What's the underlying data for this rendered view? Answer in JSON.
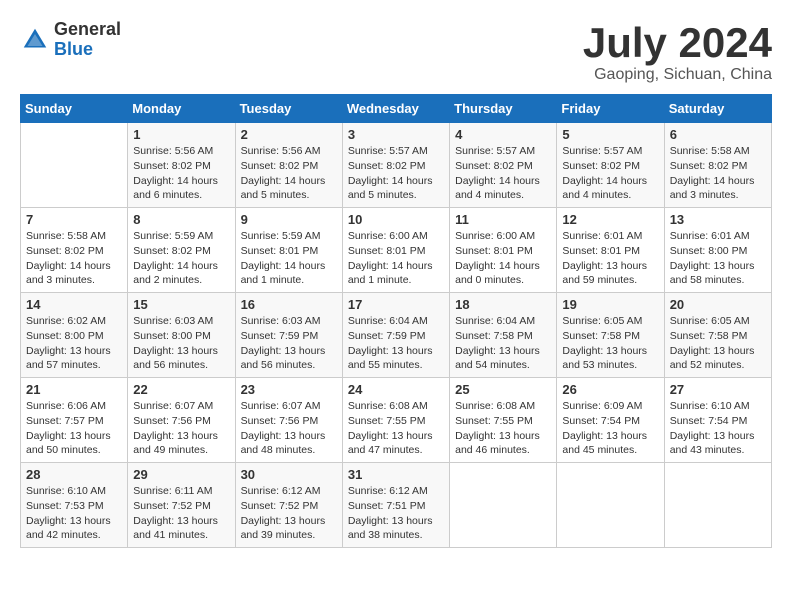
{
  "logo": {
    "general": "General",
    "blue": "Blue"
  },
  "title": {
    "month_year": "July 2024",
    "location": "Gaoping, Sichuan, China"
  },
  "calendar": {
    "headers": [
      "Sunday",
      "Monday",
      "Tuesday",
      "Wednesday",
      "Thursday",
      "Friday",
      "Saturday"
    ],
    "weeks": [
      [
        {
          "day": "",
          "sunrise": "",
          "sunset": "",
          "daylight": ""
        },
        {
          "day": "1",
          "sunrise": "Sunrise: 5:56 AM",
          "sunset": "Sunset: 8:02 PM",
          "daylight": "Daylight: 14 hours and 6 minutes."
        },
        {
          "day": "2",
          "sunrise": "Sunrise: 5:56 AM",
          "sunset": "Sunset: 8:02 PM",
          "daylight": "Daylight: 14 hours and 5 minutes."
        },
        {
          "day": "3",
          "sunrise": "Sunrise: 5:57 AM",
          "sunset": "Sunset: 8:02 PM",
          "daylight": "Daylight: 14 hours and 5 minutes."
        },
        {
          "day": "4",
          "sunrise": "Sunrise: 5:57 AM",
          "sunset": "Sunset: 8:02 PM",
          "daylight": "Daylight: 14 hours and 4 minutes."
        },
        {
          "day": "5",
          "sunrise": "Sunrise: 5:57 AM",
          "sunset": "Sunset: 8:02 PM",
          "daylight": "Daylight: 14 hours and 4 minutes."
        },
        {
          "day": "6",
          "sunrise": "Sunrise: 5:58 AM",
          "sunset": "Sunset: 8:02 PM",
          "daylight": "Daylight: 14 hours and 3 minutes."
        }
      ],
      [
        {
          "day": "7",
          "sunrise": "Sunrise: 5:58 AM",
          "sunset": "Sunset: 8:02 PM",
          "daylight": "Daylight: 14 hours and 3 minutes."
        },
        {
          "day": "8",
          "sunrise": "Sunrise: 5:59 AM",
          "sunset": "Sunset: 8:02 PM",
          "daylight": "Daylight: 14 hours and 2 minutes."
        },
        {
          "day": "9",
          "sunrise": "Sunrise: 5:59 AM",
          "sunset": "Sunset: 8:01 PM",
          "daylight": "Daylight: 14 hours and 1 minute."
        },
        {
          "day": "10",
          "sunrise": "Sunrise: 6:00 AM",
          "sunset": "Sunset: 8:01 PM",
          "daylight": "Daylight: 14 hours and 1 minute."
        },
        {
          "day": "11",
          "sunrise": "Sunrise: 6:00 AM",
          "sunset": "Sunset: 8:01 PM",
          "daylight": "Daylight: 14 hours and 0 minutes."
        },
        {
          "day": "12",
          "sunrise": "Sunrise: 6:01 AM",
          "sunset": "Sunset: 8:01 PM",
          "daylight": "Daylight: 13 hours and 59 minutes."
        },
        {
          "day": "13",
          "sunrise": "Sunrise: 6:01 AM",
          "sunset": "Sunset: 8:00 PM",
          "daylight": "Daylight: 13 hours and 58 minutes."
        }
      ],
      [
        {
          "day": "14",
          "sunrise": "Sunrise: 6:02 AM",
          "sunset": "Sunset: 8:00 PM",
          "daylight": "Daylight: 13 hours and 57 minutes."
        },
        {
          "day": "15",
          "sunrise": "Sunrise: 6:03 AM",
          "sunset": "Sunset: 8:00 PM",
          "daylight": "Daylight: 13 hours and 56 minutes."
        },
        {
          "day": "16",
          "sunrise": "Sunrise: 6:03 AM",
          "sunset": "Sunset: 7:59 PM",
          "daylight": "Daylight: 13 hours and 56 minutes."
        },
        {
          "day": "17",
          "sunrise": "Sunrise: 6:04 AM",
          "sunset": "Sunset: 7:59 PM",
          "daylight": "Daylight: 13 hours and 55 minutes."
        },
        {
          "day": "18",
          "sunrise": "Sunrise: 6:04 AM",
          "sunset": "Sunset: 7:58 PM",
          "daylight": "Daylight: 13 hours and 54 minutes."
        },
        {
          "day": "19",
          "sunrise": "Sunrise: 6:05 AM",
          "sunset": "Sunset: 7:58 PM",
          "daylight": "Daylight: 13 hours and 53 minutes."
        },
        {
          "day": "20",
          "sunrise": "Sunrise: 6:05 AM",
          "sunset": "Sunset: 7:58 PM",
          "daylight": "Daylight: 13 hours and 52 minutes."
        }
      ],
      [
        {
          "day": "21",
          "sunrise": "Sunrise: 6:06 AM",
          "sunset": "Sunset: 7:57 PM",
          "daylight": "Daylight: 13 hours and 50 minutes."
        },
        {
          "day": "22",
          "sunrise": "Sunrise: 6:07 AM",
          "sunset": "Sunset: 7:56 PM",
          "daylight": "Daylight: 13 hours and 49 minutes."
        },
        {
          "day": "23",
          "sunrise": "Sunrise: 6:07 AM",
          "sunset": "Sunset: 7:56 PM",
          "daylight": "Daylight: 13 hours and 48 minutes."
        },
        {
          "day": "24",
          "sunrise": "Sunrise: 6:08 AM",
          "sunset": "Sunset: 7:55 PM",
          "daylight": "Daylight: 13 hours and 47 minutes."
        },
        {
          "day": "25",
          "sunrise": "Sunrise: 6:08 AM",
          "sunset": "Sunset: 7:55 PM",
          "daylight": "Daylight: 13 hours and 46 minutes."
        },
        {
          "day": "26",
          "sunrise": "Sunrise: 6:09 AM",
          "sunset": "Sunset: 7:54 PM",
          "daylight": "Daylight: 13 hours and 45 minutes."
        },
        {
          "day": "27",
          "sunrise": "Sunrise: 6:10 AM",
          "sunset": "Sunset: 7:54 PM",
          "daylight": "Daylight: 13 hours and 43 minutes."
        }
      ],
      [
        {
          "day": "28",
          "sunrise": "Sunrise: 6:10 AM",
          "sunset": "Sunset: 7:53 PM",
          "daylight": "Daylight: 13 hours and 42 minutes."
        },
        {
          "day": "29",
          "sunrise": "Sunrise: 6:11 AM",
          "sunset": "Sunset: 7:52 PM",
          "daylight": "Daylight: 13 hours and 41 minutes."
        },
        {
          "day": "30",
          "sunrise": "Sunrise: 6:12 AM",
          "sunset": "Sunset: 7:52 PM",
          "daylight": "Daylight: 13 hours and 39 minutes."
        },
        {
          "day": "31",
          "sunrise": "Sunrise: 6:12 AM",
          "sunset": "Sunset: 7:51 PM",
          "daylight": "Daylight: 13 hours and 38 minutes."
        },
        {
          "day": "",
          "sunrise": "",
          "sunset": "",
          "daylight": ""
        },
        {
          "day": "",
          "sunrise": "",
          "sunset": "",
          "daylight": ""
        },
        {
          "day": "",
          "sunrise": "",
          "sunset": "",
          "daylight": ""
        }
      ]
    ]
  }
}
